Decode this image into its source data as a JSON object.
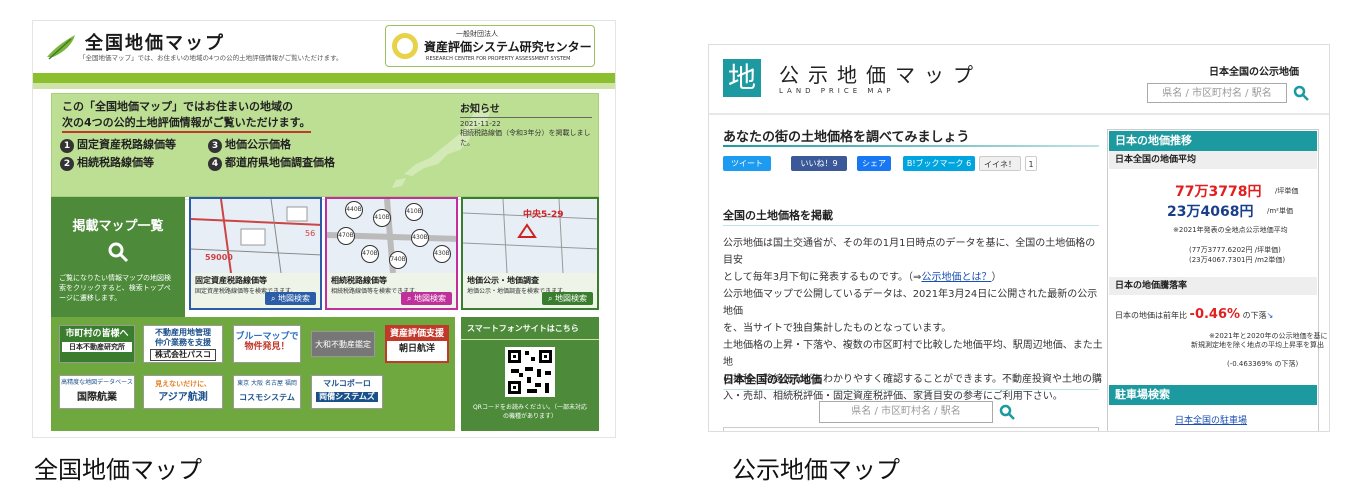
{
  "left_site": {
    "logo_title": "全国地価マップ",
    "logo_sub": "「全国地価マップ」では、お住まいの地域の4つの公的土地評価情報がご覧いただけます。",
    "org_prefix": "一般財団法人",
    "org_name": "資産評価システム研究センター",
    "org_en": "RESEARCH CENTER FOR PROPERTY ASSESSMENT SYSTEM",
    "hero_line1": "この「全国地価マップ」ではお住まいの地域の",
    "hero_line2": "次の4つの公的土地評価情報がご覧いただけます。",
    "items": [
      "固定資産税路線価等",
      "地価公示価格",
      "相続税路線価等",
      "都道府県地価調査価格"
    ],
    "item_nums": [
      "1",
      "3",
      "2",
      "4"
    ],
    "notice_title": "お知らせ",
    "notice_date": "2021-11-22",
    "notice_text": "相続税路線価（令和3年分）を掲載しました。",
    "map_list_title": "掲載マップ一覧",
    "map_list_desc": "ご覧になりたい情報マップの地図検索をクリックすると、検索トップページに遷移します。",
    "tiles": [
      {
        "title": "固定資産税路線価等",
        "desc": "固定資産税路線価等を検索できます。",
        "button": "地図検索",
        "color": "#2a5ca8"
      },
      {
        "title": "相続税路線価等",
        "desc": "相続税路線価等を検索できます。",
        "button": "地図検索",
        "color": "#c0309a"
      },
      {
        "title": "地価公示・地価調査",
        "desc": "地価公示・地価調査を検索できます。",
        "button": "地図検索",
        "color": "#3a7d2e"
      }
    ],
    "tile1_labels": [
      "59000",
      "56"
    ],
    "tile2_labels": [
      "440B",
      "410B",
      "410B",
      "470B",
      "470B",
      "430B",
      "430B",
      "740B"
    ],
    "tile3_label": "中央5-29",
    "banners": {
      "b1a": "市町村の皆様へ",
      "b1b": "日本不動産研究所",
      "b2a": "不動産用地管理",
      "b2b": "仲介業務を支援",
      "b2c": "株式会社パスコ",
      "b3a": "ブルーマップで",
      "b3b": "物件発見！",
      "b4": "大和不動産鑑定",
      "b5a": "資産評価支援",
      "b5b": "朝日航洋",
      "b6a": "高精度な地図データベース",
      "b6b": "国際航業",
      "b7a": "見えないだけに、",
      "b7b": "アジア航測",
      "b8a": "東京 大阪 名古屋 福岡",
      "b8b": "コスモシステム",
      "b9a": "マルコポーロ",
      "b9b": "両備システムズ"
    },
    "smartphone_title": "スマートフォンサイトはこちら",
    "qr_text": "QRコードをお読みください。（一部未対応の機種があります）"
  },
  "right_site": {
    "logo_kanji": "地",
    "logo_title": "公示地価マップ",
    "logo_en": "LAND PRICE MAP",
    "header_right": "日本全国の公示地価",
    "search_placeholder": "県名 / 市区町村名 / 駅名",
    "main_title": "あなたの街の土地価格を調べてみましょう",
    "sns": [
      {
        "label": "ツイート",
        "color": "#1d9bf0"
      },
      {
        "label": "いいね！9",
        "color": "#3b5998"
      },
      {
        "label": "シェア",
        "color": "#1877f2"
      },
      {
        "label": "B!ブックマーク 6",
        "color": "#00a4de"
      },
      {
        "label": "イイネ！",
        "color": "#f0f0f0"
      }
    ],
    "sns_count": "1",
    "section1_title": "全国の土地価格を掲載",
    "para1_line1": "公示地価は国土交通省が、その年の1月1日時点のデータを基に、全国の土地価格の目安",
    "para1_line2": "として毎年3月下旬に発表するものです。（⇒",
    "para1_link": "公示地価とは？",
    "para1_end": "）",
    "para2_line1": "公示地価マップで公開しているデータは、2021年3月24日に公開された最新の公示地価",
    "para2_line2": "を、当サイトで独自集計したものとなっています。",
    "para3_line1": "土地価格の上昇・下落や、複数の市区町村で比較した地価平均、駅周辺地価、また土地",
    "para3_line2": "の推移、路線価などもわかりやすく確認することができます。不動産投資や土地の購",
    "para3_line3": "入・売却、相続税評価・固定資産税評価、家賃目安の参考にご利用下さい。",
    "section2_title": "日本全国の公示地価",
    "side1_title": "日本の地価推移",
    "side1_sub": "日本全国の地価平均",
    "price_tsubo": "77万3778円",
    "unit_tsubo": "/坪単価",
    "price_m2": "23万4068円",
    "unit_m2": "/m²単価",
    "side1_note": "※2021年発表の全地点公示地価平均",
    "side1_detail1": "(77万3777.6202円 /坪単価)",
    "side1_detail2": "(23万4067.7301円 /m2単価)",
    "side2_title": "日本の地価騰落率",
    "decline_prefix": "日本の地価は前年比",
    "decline_value": "-0.46%",
    "decline_suffix": "の下落",
    "side2_note1": "※2021年と2020年の公示地価を基に",
    "side2_note2": "新規測定地を除く地点の平均上昇率を算出",
    "side2_detail": "(-0.463369% の下落)",
    "side3_title": "駐車場検索",
    "side3_link": "日本全国の駐車場"
  },
  "captions": {
    "left": "全国地価マップ",
    "right": "公示地価マップ"
  }
}
